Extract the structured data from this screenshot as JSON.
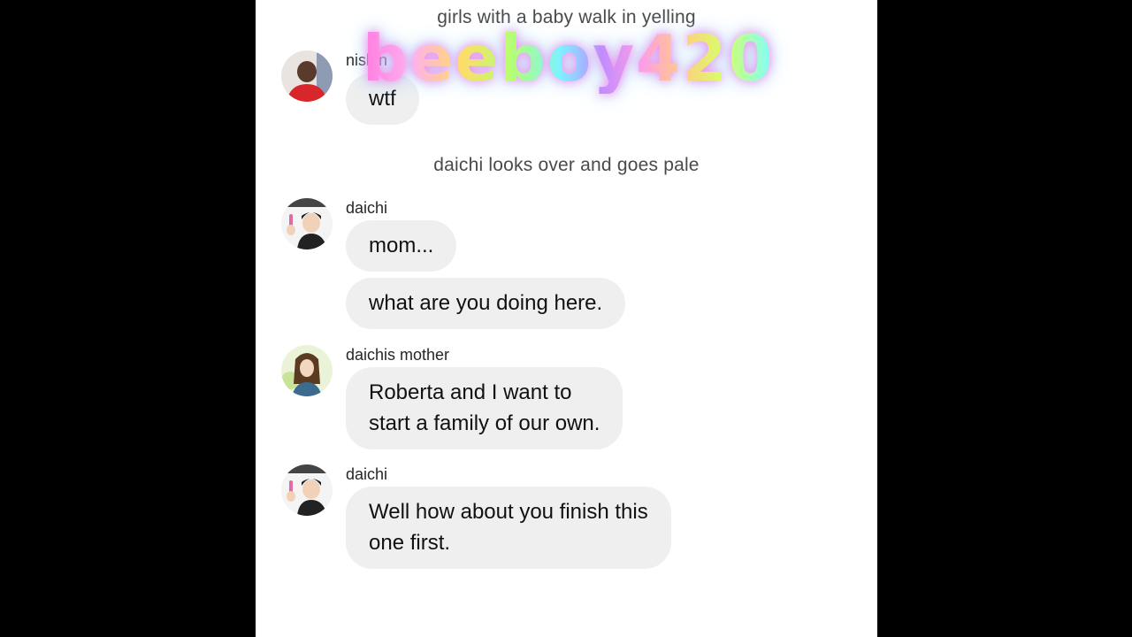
{
  "notes": {
    "top": "girls with a baby walk in yelling",
    "middle": "daichi looks over and goes pale"
  },
  "messages": [
    {
      "sender": "nishin",
      "avatar_icon": "red-shirt-avatar-icon",
      "texts": [
        "wtf"
      ]
    },
    {
      "sender": "daichi",
      "avatar_icon": "daichi-avatar-icon",
      "texts": [
        "mom...",
        "what are you doing here."
      ]
    },
    {
      "sender": "daichis mother",
      "avatar_icon": "mother-avatar-icon",
      "texts": [
        "Roberta and I want to\nstart a family of our own."
      ]
    },
    {
      "sender": "daichi",
      "avatar_icon": "daichi-avatar-icon",
      "texts": [
        "Well how about you finish this\none first."
      ]
    }
  ],
  "watermark": "beeboy420",
  "colors": {
    "bubble": "#efefef",
    "background": "#ffffff",
    "letterbox": "#000000"
  }
}
